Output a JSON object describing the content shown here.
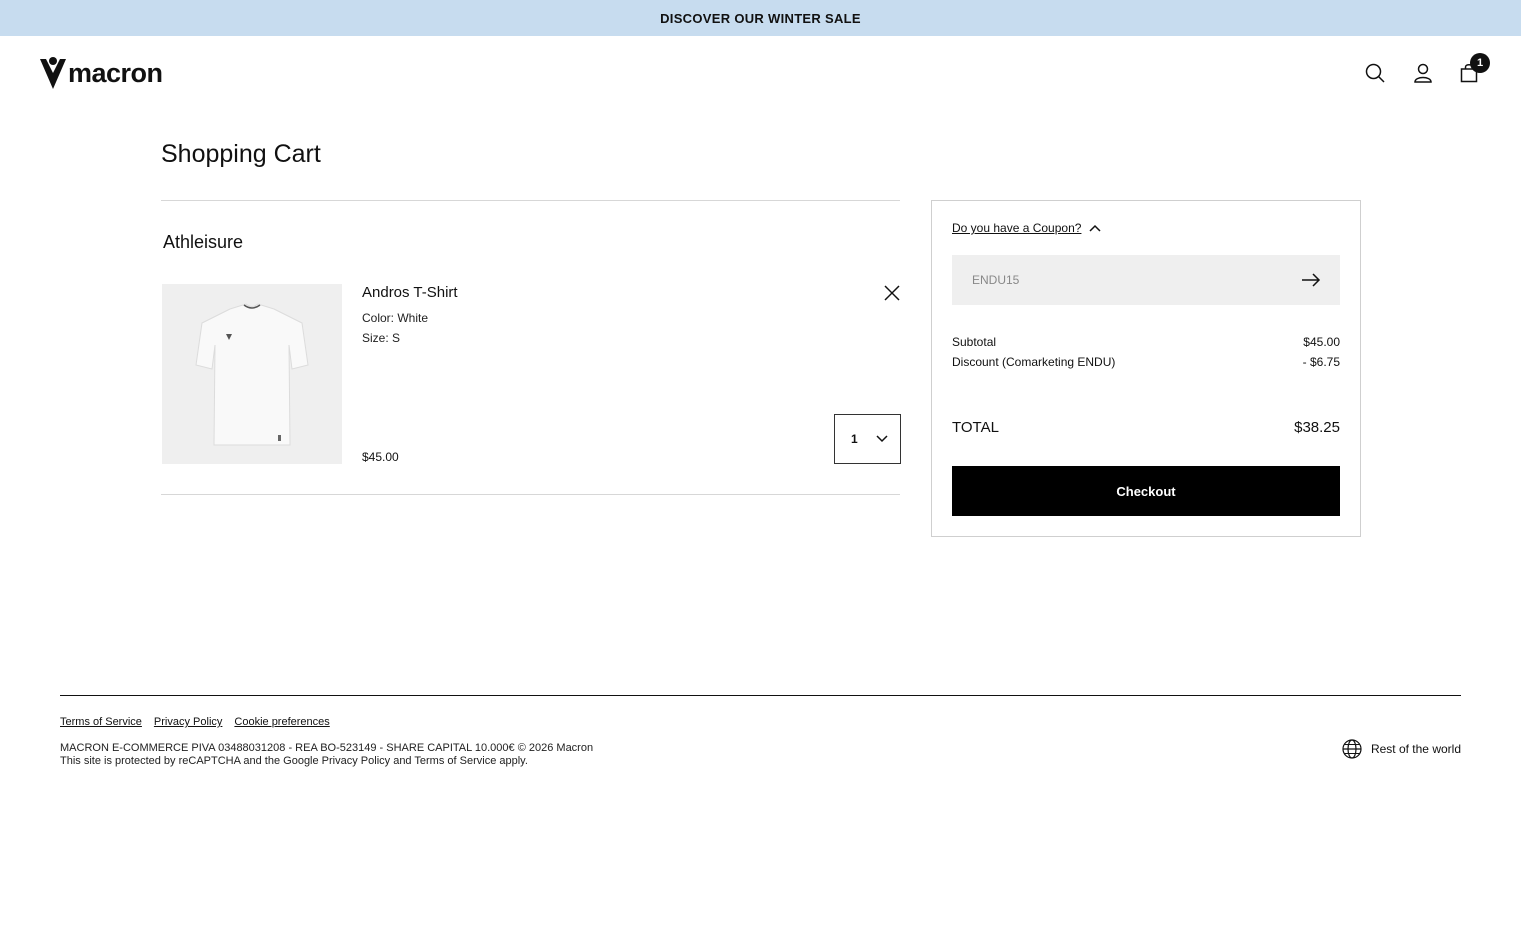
{
  "announcement": {
    "text": "DISCOVER OUR WINTER SALE"
  },
  "header": {
    "logo_text": "macron",
    "icons": [
      "search-icon",
      "user-icon",
      "cart-icon"
    ],
    "cart_count": "1"
  },
  "page": {
    "title": "Shopping Cart"
  },
  "cart": {
    "section_title": "Athleisure",
    "item": {
      "name": "Andros T-Shirt",
      "color": "Color: White",
      "size": "Size: S",
      "price": "$45.00",
      "quantity": "1"
    }
  },
  "summary": {
    "coupon_toggle": "Do you have a Coupon?",
    "coupon_value": "ENDU15",
    "subtotal_label": "Subtotal",
    "subtotal_value": "$45.00",
    "discount_label": "Discount (Comarketing ENDU)",
    "discount_value": "- $6.75",
    "total_label": "TOTAL",
    "total_value": "$38.25",
    "checkout_label": "Checkout"
  },
  "footer": {
    "links": [
      "Terms of Service",
      "Privacy Policy",
      "Cookie preferences"
    ],
    "legal_line1": "MACRON E-COMMERCE PIVA 03488031208 - REA BO-523149 - SHARE CAPITAL 10.000€ © 2026 Macron",
    "legal_line2": "This site is protected by reCAPTCHA and the Google Privacy Policy and Terms of Service apply.",
    "region": "Rest of the world"
  },
  "colors": {
    "announcement_bg": "#c7dcef",
    "checkout_bg": "#000000",
    "coupon_bg": "#efefef"
  }
}
